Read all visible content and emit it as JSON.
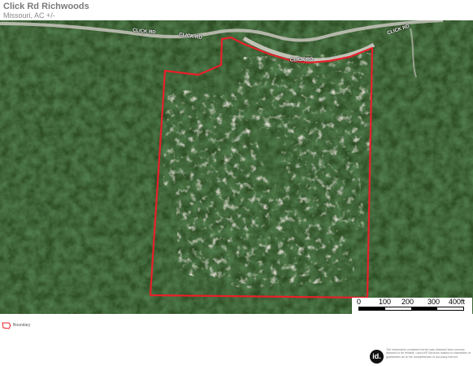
{
  "header": {
    "title": "Click Rd Richwoods",
    "subtitle": "Missouri, AC +/-"
  },
  "map": {
    "road_labels": [
      "CLICK RD",
      "CLICK RD",
      "CLICK RD",
      "CLICK RD"
    ],
    "boundary_color": "#e8202a",
    "forest_color": "#1f3a1a"
  },
  "scale": {
    "labels": [
      "0",
      "100",
      "200",
      "300",
      "400ft"
    ]
  },
  "legend": {
    "label": "Boundary"
  },
  "logo": {
    "text": "id."
  },
  "disclaimer": {
    "text": "The information contained herein was obtained from sources deemed to be reliable. Land id® Services makes no warranties or guarantees as to the completeness or accuracy thereof."
  }
}
